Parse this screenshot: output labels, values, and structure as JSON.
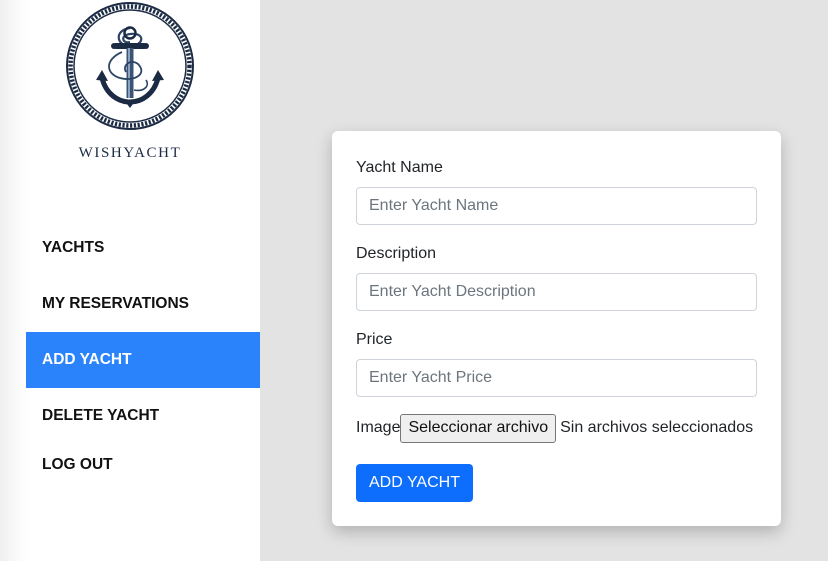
{
  "brand": {
    "name": "WISHYACHT",
    "logo_icon": "anchor-rope-circle-icon",
    "logo_color": "#1c2b44"
  },
  "sidebar": {
    "items": [
      {
        "label": "YACHTS",
        "active": false
      },
      {
        "label": "MY RESERVATIONS",
        "active": false
      },
      {
        "label": "ADD YACHT",
        "active": true
      },
      {
        "label": "DELETE YACHT",
        "active": false
      },
      {
        "label": "LOG OUT",
        "active": false
      }
    ],
    "active_color": "#2a83fa"
  },
  "form": {
    "name_label": "Yacht Name",
    "name_placeholder": "Enter Yacht Name",
    "name_value": "",
    "description_label": "Description",
    "description_placeholder": "Enter Yacht Description",
    "description_value": "",
    "price_label": "Price",
    "price_placeholder": "Enter Yacht Price",
    "price_value": "",
    "image_label": "Image",
    "file_button": "Seleccionar archivo",
    "file_status": "Sin archivos seleccionados",
    "submit_label": "ADD YACHT",
    "submit_color": "#0d6efd"
  }
}
